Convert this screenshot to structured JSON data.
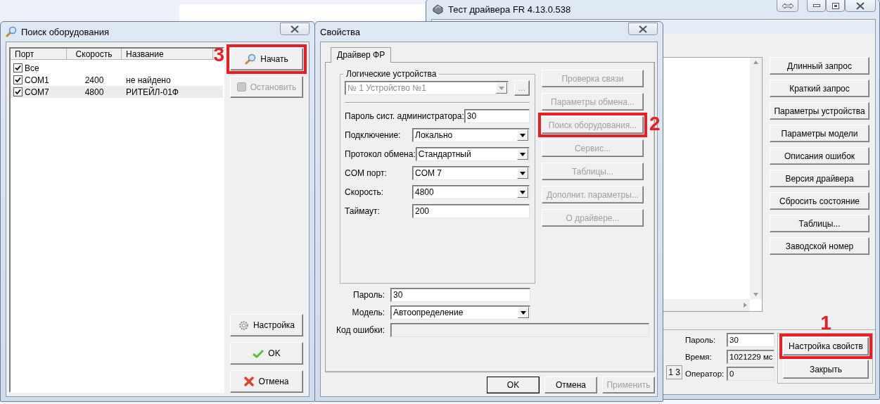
{
  "main_window": {
    "title": "Тест драйвера FR 4.13.0.538",
    "side_buttons": [
      {
        "label": "Длинный запрос"
      },
      {
        "label": "Краткий запрос"
      },
      {
        "label": "Параметры устройства"
      },
      {
        "label": "Параметры модели"
      },
      {
        "label": "Описания ошибок"
      },
      {
        "label": "Версия драйвера"
      },
      {
        "label": "Сбросить состояние"
      },
      {
        "label": "Таблицы..."
      },
      {
        "label": "Заводской номер"
      }
    ],
    "cut_field": {
      "value": "1 3"
    },
    "status_fields": [
      {
        "label": "Пароль:",
        "value": "30",
        "readonly": false
      },
      {
        "label": "Время:",
        "value": "1021229 мс",
        "readonly": true
      },
      {
        "label": "Оператор:",
        "value": "0",
        "readonly": true
      }
    ],
    "buttons": [
      {
        "label": "Настройка свойств",
        "callout": "1"
      },
      {
        "label": "Закрыть"
      }
    ]
  },
  "search_window": {
    "title": "Поиск оборудования",
    "columns": [
      "Порт",
      "Скорость",
      "Название"
    ],
    "rows": [
      {
        "port": "Все",
        "checked": true,
        "selected": false
      },
      {
        "port": "COM1",
        "speed": "2400",
        "name": "не найдено",
        "checked": true,
        "selected": false
      },
      {
        "port": "COM7",
        "speed": "4800",
        "name": "РИТЕЙЛ-01Ф",
        "checked": true,
        "selected": true
      }
    ],
    "top_buttons": [
      {
        "label": "Начать",
        "disabled": false,
        "callout": "3"
      },
      {
        "label": "Остановить",
        "disabled": true
      }
    ],
    "bottom_buttons": [
      {
        "label": "Настройка",
        "disabled": false
      },
      {
        "label": "OK",
        "disabled": false
      },
      {
        "label": "Отмена",
        "disabled": false
      }
    ]
  },
  "properties_window": {
    "title": "Свойства",
    "tabs": [
      {
        "label": "Драйвер ФР",
        "selected": true
      }
    ],
    "group_title": "Логические устройства",
    "device_select": {
      "value": "№ 1 Устройство №1",
      "disabled": true
    },
    "browse_button": {
      "label": "...",
      "disabled": true
    },
    "fields": [
      {
        "label": "Пароль сист. администратора:",
        "value": "30",
        "kind": "text"
      },
      {
        "label": "Подключение:",
        "value": "Локально",
        "kind": "select"
      },
      {
        "label": "Протокол обмена:",
        "value": "Стандартный",
        "kind": "select"
      },
      {
        "label": "COM порт:",
        "value": "COM 7",
        "kind": "select"
      },
      {
        "label": "Скорость:",
        "value": "4800",
        "kind": "select"
      },
      {
        "label": "Таймаут:",
        "value": "200",
        "kind": "text"
      }
    ],
    "side_buttons": [
      {
        "label": "Проверка связи",
        "disabled": true
      },
      {
        "label": "Параметры обмена...",
        "disabled": true
      },
      {
        "label": "Поиск оборудования...",
        "disabled": true,
        "callout": "2"
      },
      {
        "label": "Сервис...",
        "disabled": true
      },
      {
        "label": "Таблицы...",
        "disabled": true
      },
      {
        "label": "Дополнит. параметры...",
        "disabled": true
      },
      {
        "label": "О драйвере...",
        "disabled": true
      }
    ],
    "lower_fields": [
      {
        "label": "Пароль:",
        "value": "30",
        "kind": "text"
      },
      {
        "label": "Модель:",
        "value": "Автоопределение",
        "kind": "select"
      },
      {
        "label": "Код ошибки:",
        "kind": "readonly"
      }
    ],
    "footer_buttons": [
      {
        "label": "OK",
        "disabled": false,
        "default": true
      },
      {
        "label": "Отмена",
        "disabled": false,
        "default": false
      },
      {
        "label": "Применить",
        "disabled": true,
        "default": false
      }
    ]
  }
}
